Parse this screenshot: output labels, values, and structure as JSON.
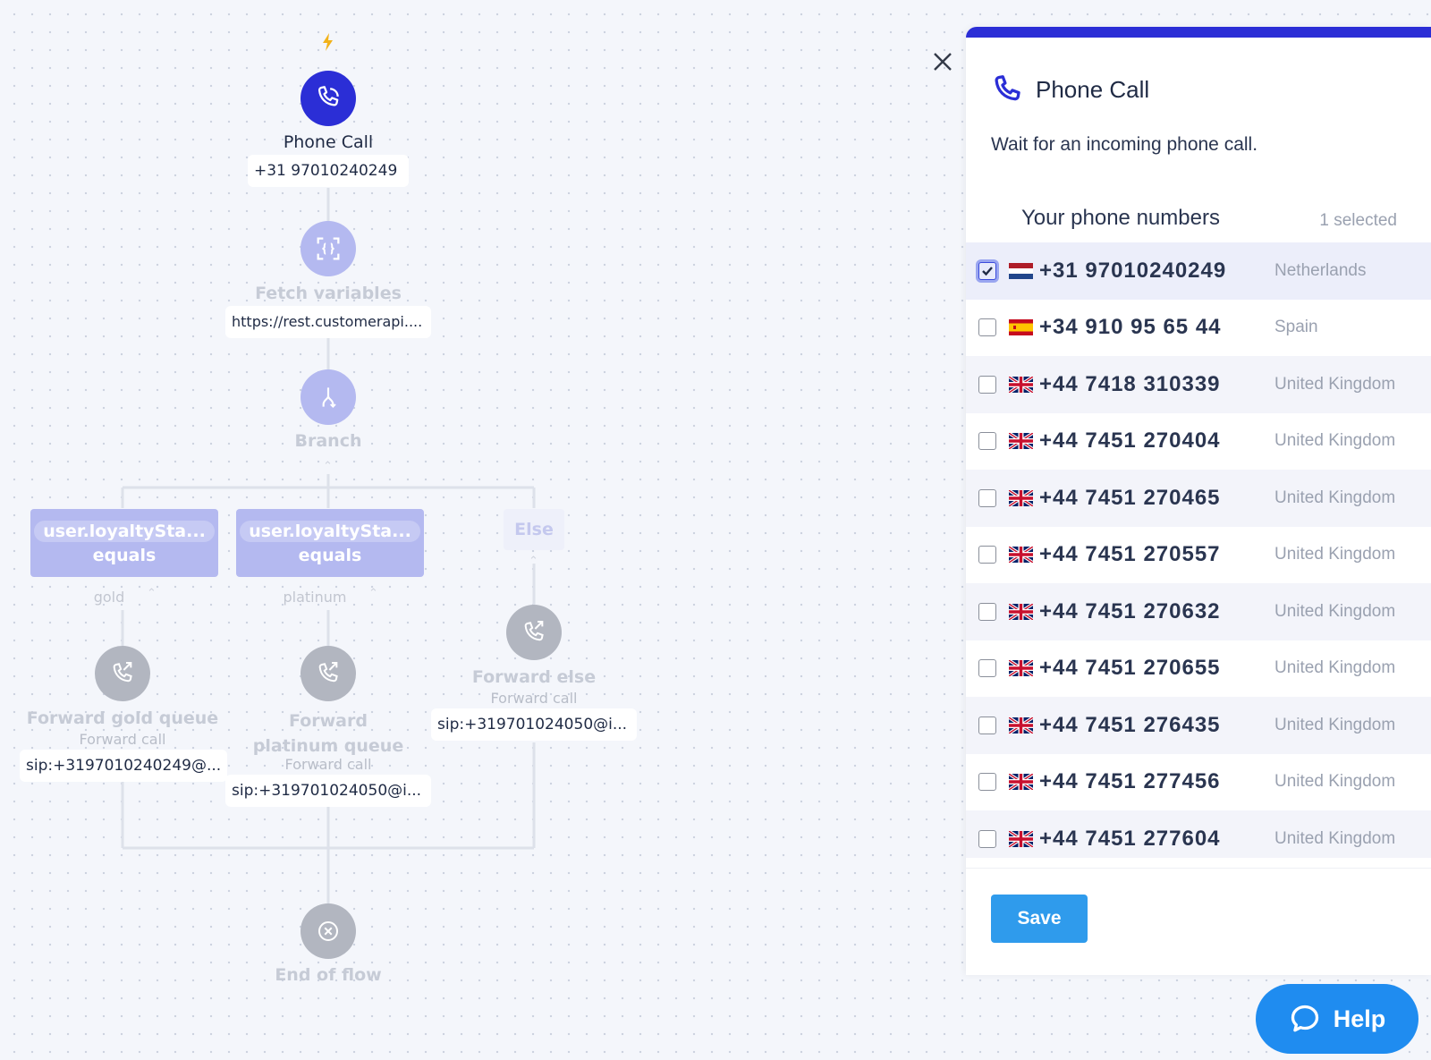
{
  "flow": {
    "trigger": {
      "title": "Phone Call",
      "value": "+31 97010240249"
    },
    "fetch": {
      "title": "Fetch variables",
      "value": "https://rest.customerapi...."
    },
    "branch": {
      "title": "Branch"
    },
    "conditions": [
      {
        "field": "user.loyaltySta...",
        "operator": "equals",
        "value": "gold"
      },
      {
        "field": "user.loyaltySta...",
        "operator": "equals",
        "value": "platinum"
      }
    ],
    "else_label": "Else",
    "forwards": [
      {
        "title": "Forward gold queue",
        "type": "Forward call",
        "target": "sip:+3197010240249@..."
      },
      {
        "title": "Forward platinum queue",
        "type": "Forward call",
        "target": "sip:+319701024050@i..."
      },
      {
        "title": "Forward else",
        "type": "Forward call",
        "target": "sip:+319701024050@i..."
      }
    ],
    "end": {
      "title": "End of flow"
    }
  },
  "panel": {
    "title": "Phone Call",
    "description": "Wait for an incoming phone call.",
    "section_title": "Your phone numbers",
    "selected_count": "1 selected",
    "numbers": [
      {
        "number": "+31 97010240249",
        "country": "Netherlands",
        "flag": "nl",
        "checked": true
      },
      {
        "number": "+34 910 95 65 44",
        "country": "Spain",
        "flag": "es",
        "checked": false
      },
      {
        "number": "+44 7418 310339",
        "country": "United Kingdom",
        "flag": "gb",
        "checked": false
      },
      {
        "number": "+44 7451 270404",
        "country": "United Kingdom",
        "flag": "gb",
        "checked": false
      },
      {
        "number": "+44 7451 270465",
        "country": "United Kingdom",
        "flag": "gb",
        "checked": false
      },
      {
        "number": "+44 7451 270557",
        "country": "United Kingdom",
        "flag": "gb",
        "checked": false
      },
      {
        "number": "+44 7451 270632",
        "country": "United Kingdom",
        "flag": "gb",
        "checked": false
      },
      {
        "number": "+44 7451 270655",
        "country": "United Kingdom",
        "flag": "gb",
        "checked": false
      },
      {
        "number": "+44 7451 276435",
        "country": "United Kingdom",
        "flag": "gb",
        "checked": false
      },
      {
        "number": "+44 7451 277456",
        "country": "United Kingdom",
        "flag": "gb",
        "checked": false
      },
      {
        "number": "+44 7451 277604",
        "country": "United Kingdom",
        "flag": "gb",
        "checked": false
      }
    ],
    "save_label": "Save"
  },
  "help_label": "Help",
  "colors": {
    "accent": "#2b2ed6",
    "save": "#2f9bec",
    "help": "#1f8cf0",
    "trigger": "#2b2ed6"
  },
  "icons": [
    "lightning-icon",
    "phone-icon",
    "fetch-variables-icon",
    "branch-icon",
    "forward-call-icon",
    "end-flow-icon",
    "close-icon",
    "chat-bubble-icon"
  ]
}
